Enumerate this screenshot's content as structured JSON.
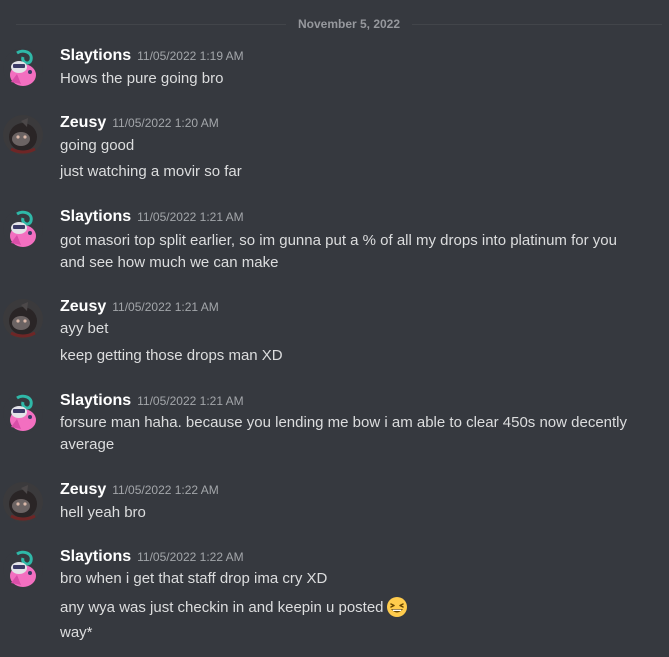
{
  "date_divider": "November 5, 2022",
  "messages": [
    {
      "author": "Slaytions",
      "timestamp": "11/05/2022 1:19 AM",
      "lines": [
        "Hows the pure going bro"
      ]
    },
    {
      "author": "Zeusy",
      "timestamp": "11/05/2022 1:20 AM",
      "lines": [
        "going good",
        "just watching a movir so far"
      ]
    },
    {
      "author": "Slaytions",
      "timestamp": "11/05/2022 1:21 AM",
      "lines": [
        "got masori top split earlier, so im gunna put a % of all my drops into platinum for you",
        "and see how much we can make"
      ]
    },
    {
      "author": "Zeusy",
      "timestamp": "11/05/2022 1:21 AM",
      "lines": [
        "ayy bet",
        "keep getting those drops man XD"
      ]
    },
    {
      "author": "Slaytions",
      "timestamp": "11/05/2022 1:21 AM",
      "lines": [
        "forsure man haha. because you lending me bow i am able to clear 450s now decently",
        "average"
      ]
    },
    {
      "author": "Zeusy",
      "timestamp": "11/05/2022 1:22 AM",
      "lines": [
        "hell yeah bro"
      ]
    },
    {
      "author": "Slaytions",
      "timestamp": "11/05/2022 1:22 AM",
      "lines": [
        "bro when i get that staff drop ima cry XD",
        "any wya was just checkin in and keepin u posted",
        "way*"
      ]
    }
  ],
  "emoji": "grinning-squinting-face",
  "colors": {
    "background": "#36393f",
    "username": "#ffffff",
    "text": "#dcddde",
    "timestamp": "#a3a6aa",
    "divider": "#42454a"
  }
}
